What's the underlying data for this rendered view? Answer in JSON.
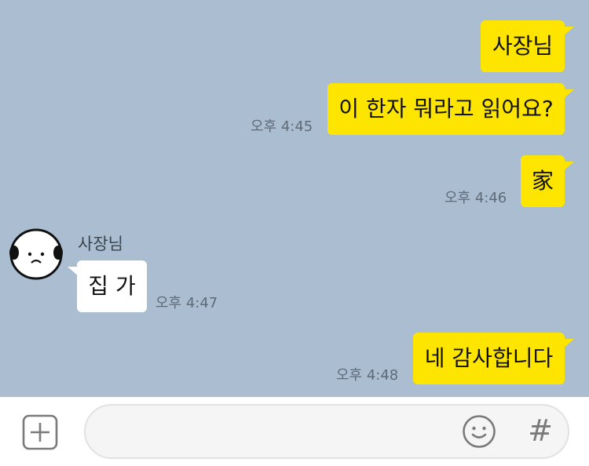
{
  "messages": [
    {
      "direction": "out",
      "text": "사장님",
      "time": ""
    },
    {
      "direction": "out",
      "text": "이 한자 뭐라고 읽어요?",
      "time": "오후 4:45"
    },
    {
      "direction": "out",
      "text": "家",
      "time": "오후 4:46"
    },
    {
      "direction": "in",
      "sender": "사장님",
      "text": "집 가",
      "time": "오후 4:47"
    },
    {
      "direction": "out",
      "text": "네 감사합니다",
      "time": "오후 4:48"
    }
  ],
  "input": {
    "placeholder": "",
    "value": ""
  },
  "input_bar": {
    "plus_icon": "plus-square-icon",
    "emoji_icon": "emoji-face-icon",
    "hash_label": "#"
  },
  "colors": {
    "chat_background": "#aabdd1",
    "outgoing_bubble": "#fee500",
    "incoming_bubble": "#ffffff",
    "timestamp": "#5f6b78"
  }
}
